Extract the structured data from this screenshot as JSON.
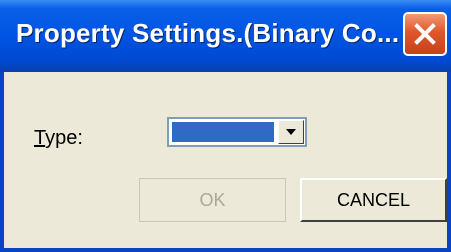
{
  "window": {
    "title": "Property Settings.(Binary Co...",
    "close_icon": "close-icon"
  },
  "form": {
    "type_label_accesskey": "T",
    "type_label_rest": "ype:",
    "type_value": "",
    "dropdown_icon": "chevron-down-icon"
  },
  "buttons": {
    "ok_label": "OK",
    "cancel_label": "CANCEL"
  },
  "colors": {
    "titlebar": "#0054e3",
    "close_button": "#e0572b",
    "dialog_bg": "#ece9d8",
    "selection": "#316ac5"
  }
}
